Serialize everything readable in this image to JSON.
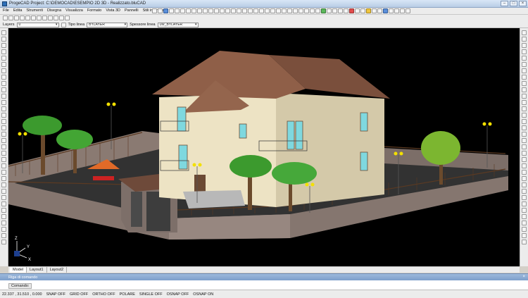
{
  "window": {
    "title": "ProgeCAD Project: C:\\DEMOCAD\\ESEMPIO 2D 3D - Realizzato.bluCAD",
    "minimize_label": "–",
    "maximize_label": "□",
    "close_label": "×"
  },
  "menu": [
    "File",
    "Edita",
    "Strumenti",
    "Disegna",
    "Visualizza",
    "Formato",
    "Vista 3D",
    "Pannelli",
    "Stili interfaccia",
    "?"
  ],
  "properties": {
    "layers_label": "Layers",
    "layer_value": "0",
    "linetype_label": "Tipo linea",
    "linetype_value": "BYLAYER",
    "lineweight_label": "Spessore linea",
    "lineweight_value": "LW_BYLAYER"
  },
  "axis": {
    "z": "Z",
    "y": "Y",
    "x": "X"
  },
  "tabs": [
    "Model",
    "Layout1",
    "Layout2"
  ],
  "command": {
    "panel_title": "Riga di comando",
    "prompt": "Comando:"
  },
  "status": {
    "coords": "22.337 , 31.510 , 0.000",
    "items": [
      "SNAP OFF",
      "GRID OFF",
      "ORTHO OFF",
      "POLARE",
      "SINGLE OFF",
      "OSNAP OFF",
      "OSNAP ON"
    ]
  },
  "colors": {
    "viewport_bg": "#000000",
    "roof": "#8a5a44",
    "wall": "#ede3c4",
    "stone": "#8c7c76",
    "window": "#7fd8df"
  }
}
